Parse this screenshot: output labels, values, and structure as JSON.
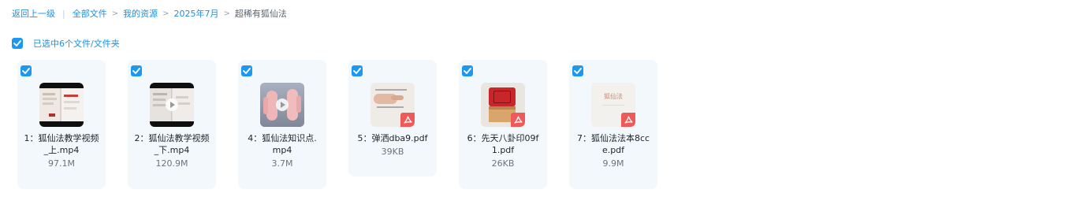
{
  "breadcrumb": {
    "back": "返回上一级",
    "separator_bar": "|",
    "separator": ">",
    "items": [
      "全部文件",
      "我的资源",
      "2025年7月",
      "超稀有狐仙法"
    ]
  },
  "selection": {
    "label": "已选中6个文件/文件夹",
    "checked": true
  },
  "files": [
    {
      "name": "1：狐仙法教学视频_上.mp4",
      "size": "97.1M",
      "type": "video",
      "checked": true
    },
    {
      "name": "2：狐仙法教学视频_下.mp4",
      "size": "120.9M",
      "type": "video",
      "checked": true
    },
    {
      "name": "4：狐仙法知识点.mp4",
      "size": "3.7M",
      "type": "video",
      "checked": true
    },
    {
      "name": "5：弹洒dba9.pdf",
      "size": "39KB",
      "type": "pdf",
      "checked": true
    },
    {
      "name": "6：先天八卦印09f1.pdf",
      "size": "26KB",
      "type": "pdf",
      "checked": true
    },
    {
      "name": "7：狐仙法法本8cce.pdf",
      "size": "9.9M",
      "type": "pdf",
      "checked": true
    }
  ],
  "thumb_text": {
    "fox_title": "狐仙法"
  },
  "colors": {
    "accent": "#1d98f0",
    "link": "#1d8fe0",
    "card_bg": "#f2f8fc",
    "pdf_badge": "#ee5a5a"
  },
  "icons": {
    "checkbox": "checkbox-checked-icon",
    "play": "play-icon",
    "pdf": "pdf-icon"
  }
}
